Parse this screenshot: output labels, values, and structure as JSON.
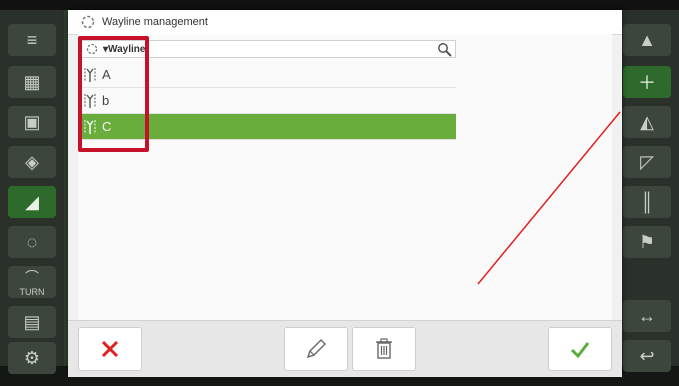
{
  "dialog": {
    "title": "Wayline management",
    "search": {
      "label": "▾Wayline"
    },
    "items": [
      {
        "label": "A",
        "selected": false
      },
      {
        "label": "b",
        "selected": false
      },
      {
        "label": "C",
        "selected": true
      }
    ]
  },
  "background": {
    "left_buttons": [
      "turn"
    ],
    "turn_label": "TURN"
  },
  "colors": {
    "selected": "#69ad3d",
    "highlight": "#c5112a",
    "cancel": "#e02020",
    "confirm": "#5aad3c",
    "preview_line": "#e02020"
  },
  "icons": {
    "title": "wayline-icon",
    "search": "search-icon",
    "cancel": "close-icon",
    "edit": "pencil-icon",
    "delete": "trash-icon",
    "confirm": "check-icon"
  }
}
